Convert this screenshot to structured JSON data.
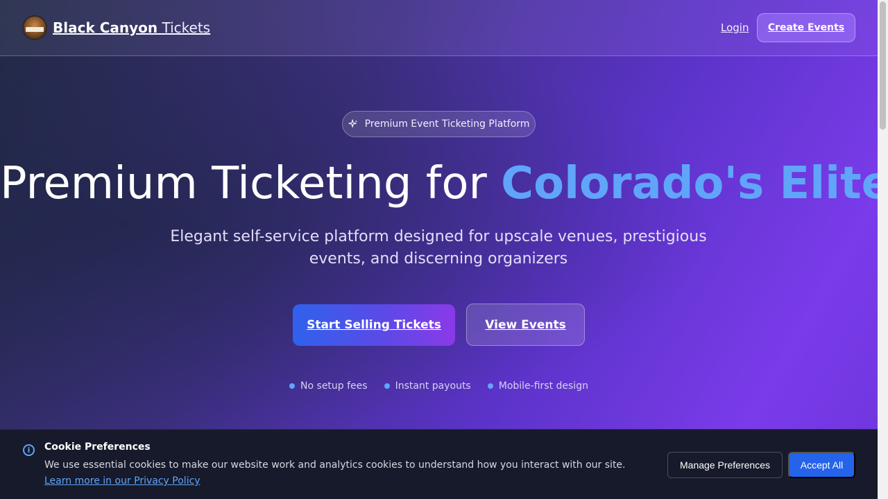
{
  "header": {
    "brand_bold": "Black Canyon",
    "brand_light": "Tickets",
    "logo_text": "BLACK CANYON TICKETS",
    "login_label": "Login",
    "create_events_label": "Create Events"
  },
  "hero": {
    "badge_icon": "sparkle-icon",
    "badge_label": "Premium Event Ticketing Platform",
    "headline_plain": "Premium Ticketing for ",
    "headline_accent": "Colorado's Elite",
    "subtitle": "Elegant self-service platform designed for upscale venues, prestigious events, and discerning organizers",
    "primary_cta": "Start Selling Tickets",
    "secondary_cta": "View Events",
    "features": [
      "No setup fees",
      "Instant payouts",
      "Mobile-first design"
    ]
  },
  "cookie_banner": {
    "icon": "info-icon",
    "title": "Cookie Preferences",
    "text": "We use essential cookies to make our website work and analytics cookies to understand how you interact with our site. ",
    "link_text": "Learn more in our Privacy Policy",
    "manage_label": "Manage Preferences",
    "accept_label": "Accept All"
  },
  "colors": {
    "accent_blue": "#60a5fa",
    "purple": "#7c3aed",
    "button_blue": "#2563eb",
    "banner_bg": "#161a2a"
  }
}
